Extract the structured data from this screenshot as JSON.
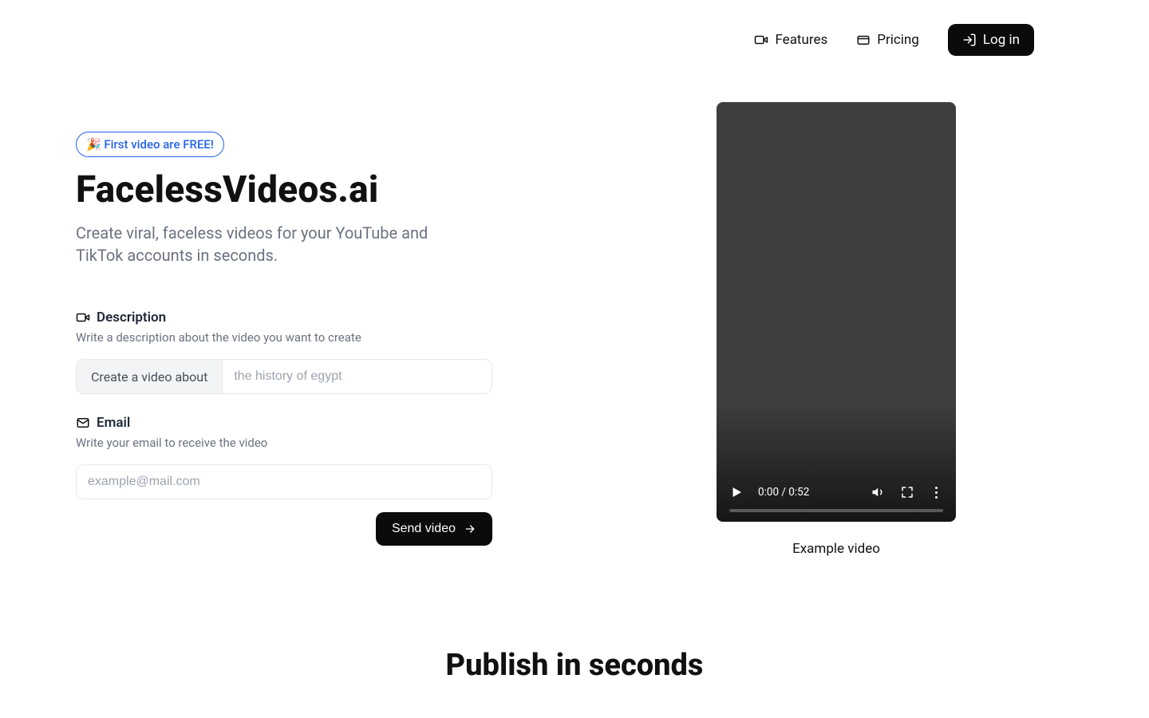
{
  "nav": {
    "features": "Features",
    "pricing": "Pricing",
    "login": "Log in"
  },
  "hero": {
    "badge": "🎉 First video are FREE!",
    "title": "FacelessVideos.ai",
    "subtitle": "Create viral, faceless videos for your YouTube and TikTok accounts in seconds."
  },
  "form": {
    "desc_label": "Description",
    "desc_help": "Write a description about the video you want to create",
    "desc_prefix": "Create a video about",
    "desc_placeholder": "the history of egypt",
    "desc_value": "",
    "email_label": "Email",
    "email_help": "Write your email to receive the video",
    "email_placeholder": "example@mail.com",
    "email_value": "",
    "submit": "Send video"
  },
  "player": {
    "time": "0:00 / 0:52",
    "caption": "Example video"
  },
  "section2": {
    "heading": "Publish in seconds"
  }
}
